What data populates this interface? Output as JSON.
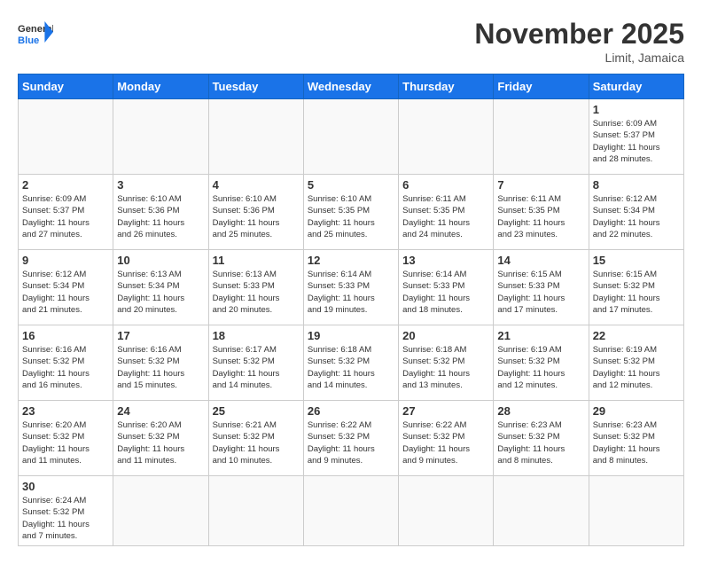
{
  "header": {
    "logo_general": "General",
    "logo_blue": "Blue",
    "month_title": "November 2025",
    "location": "Limit, Jamaica"
  },
  "weekdays": [
    "Sunday",
    "Monday",
    "Tuesday",
    "Wednesday",
    "Thursday",
    "Friday",
    "Saturday"
  ],
  "days": {
    "1": {
      "sunrise": "6:09 AM",
      "sunset": "5:37 PM",
      "daylight": "11 hours and 28 minutes."
    },
    "2": {
      "sunrise": "6:09 AM",
      "sunset": "5:37 PM",
      "daylight": "11 hours and 27 minutes."
    },
    "3": {
      "sunrise": "6:10 AM",
      "sunset": "5:36 PM",
      "daylight": "11 hours and 26 minutes."
    },
    "4": {
      "sunrise": "6:10 AM",
      "sunset": "5:36 PM",
      "daylight": "11 hours and 25 minutes."
    },
    "5": {
      "sunrise": "6:10 AM",
      "sunset": "5:35 PM",
      "daylight": "11 hours and 25 minutes."
    },
    "6": {
      "sunrise": "6:11 AM",
      "sunset": "5:35 PM",
      "daylight": "11 hours and 24 minutes."
    },
    "7": {
      "sunrise": "6:11 AM",
      "sunset": "5:35 PM",
      "daylight": "11 hours and 23 minutes."
    },
    "8": {
      "sunrise": "6:12 AM",
      "sunset": "5:34 PM",
      "daylight": "11 hours and 22 minutes."
    },
    "9": {
      "sunrise": "6:12 AM",
      "sunset": "5:34 PM",
      "daylight": "11 hours and 21 minutes."
    },
    "10": {
      "sunrise": "6:13 AM",
      "sunset": "5:34 PM",
      "daylight": "11 hours and 20 minutes."
    },
    "11": {
      "sunrise": "6:13 AM",
      "sunset": "5:33 PM",
      "daylight": "11 hours and 20 minutes."
    },
    "12": {
      "sunrise": "6:14 AM",
      "sunset": "5:33 PM",
      "daylight": "11 hours and 19 minutes."
    },
    "13": {
      "sunrise": "6:14 AM",
      "sunset": "5:33 PM",
      "daylight": "11 hours and 18 minutes."
    },
    "14": {
      "sunrise": "6:15 AM",
      "sunset": "5:33 PM",
      "daylight": "11 hours and 17 minutes."
    },
    "15": {
      "sunrise": "6:15 AM",
      "sunset": "5:32 PM",
      "daylight": "11 hours and 17 minutes."
    },
    "16": {
      "sunrise": "6:16 AM",
      "sunset": "5:32 PM",
      "daylight": "11 hours and 16 minutes."
    },
    "17": {
      "sunrise": "6:16 AM",
      "sunset": "5:32 PM",
      "daylight": "11 hours and 15 minutes."
    },
    "18": {
      "sunrise": "6:17 AM",
      "sunset": "5:32 PM",
      "daylight": "11 hours and 14 minutes."
    },
    "19": {
      "sunrise": "6:18 AM",
      "sunset": "5:32 PM",
      "daylight": "11 hours and 14 minutes."
    },
    "20": {
      "sunrise": "6:18 AM",
      "sunset": "5:32 PM",
      "daylight": "11 hours and 13 minutes."
    },
    "21": {
      "sunrise": "6:19 AM",
      "sunset": "5:32 PM",
      "daylight": "11 hours and 12 minutes."
    },
    "22": {
      "sunrise": "6:19 AM",
      "sunset": "5:32 PM",
      "daylight": "11 hours and 12 minutes."
    },
    "23": {
      "sunrise": "6:20 AM",
      "sunset": "5:32 PM",
      "daylight": "11 hours and 11 minutes."
    },
    "24": {
      "sunrise": "6:20 AM",
      "sunset": "5:32 PM",
      "daylight": "11 hours and 11 minutes."
    },
    "25": {
      "sunrise": "6:21 AM",
      "sunset": "5:32 PM",
      "daylight": "11 hours and 10 minutes."
    },
    "26": {
      "sunrise": "6:22 AM",
      "sunset": "5:32 PM",
      "daylight": "11 hours and 9 minutes."
    },
    "27": {
      "sunrise": "6:22 AM",
      "sunset": "5:32 PM",
      "daylight": "11 hours and 9 minutes."
    },
    "28": {
      "sunrise": "6:23 AM",
      "sunset": "5:32 PM",
      "daylight": "11 hours and 8 minutes."
    },
    "29": {
      "sunrise": "6:23 AM",
      "sunset": "5:32 PM",
      "daylight": "11 hours and 8 minutes."
    },
    "30": {
      "sunrise": "6:24 AM",
      "sunset": "5:32 PM",
      "daylight": "11 hours and 7 minutes."
    }
  }
}
